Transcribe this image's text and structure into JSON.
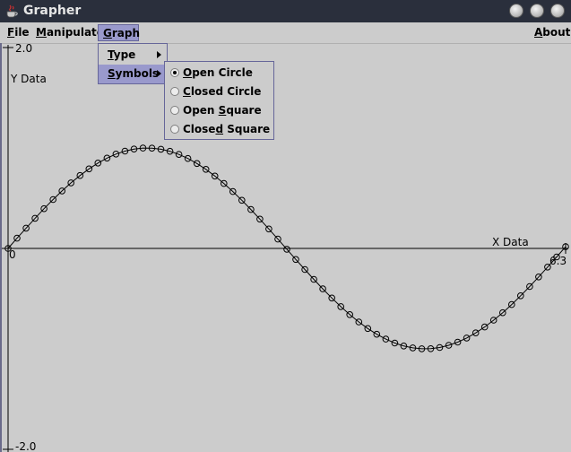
{
  "window": {
    "title": "Grapher",
    "icon": "java-cup-icon"
  },
  "menubar": {
    "items": [
      {
        "label": "File",
        "underline": "F",
        "rest": "ile"
      },
      {
        "label": "Manipulate",
        "underline": "M",
        "rest": "anipulate"
      },
      {
        "label": "Graph",
        "underline": "G",
        "rest": "raph"
      },
      {
        "label": "About",
        "underline": "A",
        "rest": "bout"
      }
    ]
  },
  "graph_menu": {
    "items": [
      {
        "label": "Type",
        "underline": "T",
        "rest": "ype"
      },
      {
        "label": "Symbols",
        "underline": "S",
        "rest": "ymbols"
      }
    ]
  },
  "symbols_menu": {
    "items": [
      {
        "label": "Open Circle",
        "pre": "",
        "underline": "O",
        "post": "pen Circle",
        "selected": true
      },
      {
        "label": "Closed Circle",
        "pre": "",
        "underline": "C",
        "post": "losed Circle",
        "selected": false
      },
      {
        "label": "Open Square",
        "pre": "Open ",
        "underline": "S",
        "post": "quare",
        "selected": false
      },
      {
        "label": "Closed Square",
        "pre": "Close",
        "underline": "d",
        "post": " Square",
        "selected": false
      }
    ]
  },
  "chart_data": {
    "type": "line",
    "title": "",
    "xlabel": "X Data",
    "ylabel": "Y Data",
    "xlim": [
      0,
      6.3
    ],
    "ylim": [
      -2.0,
      2.0
    ],
    "x_tick_labels": [
      "0",
      "6.3"
    ],
    "y_tick_labels": [
      "2.0",
      "-2.0"
    ],
    "marker": "open-circle",
    "series": [
      {
        "function": "sin",
        "x_start": 0,
        "x_end": 6.3,
        "points": 63
      }
    ]
  }
}
